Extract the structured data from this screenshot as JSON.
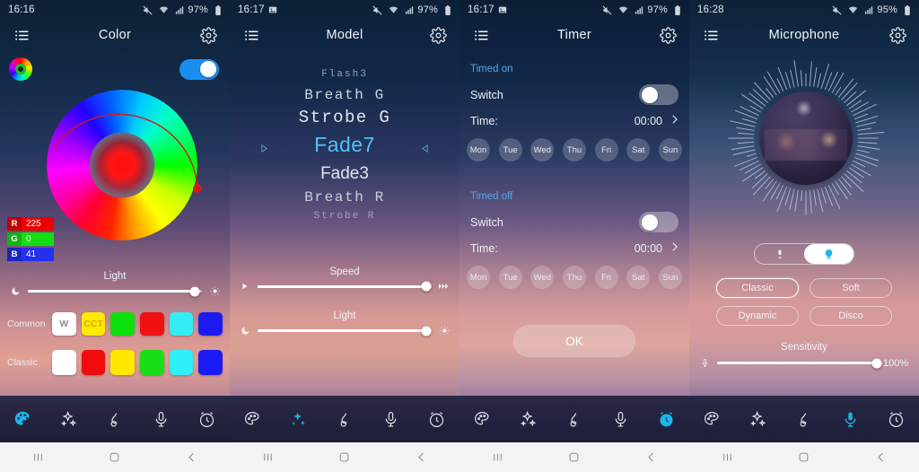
{
  "panels": [
    {
      "status": {
        "clock": "16:16",
        "battery": "97%",
        "icons": [
          "mute-icon",
          "wifi-icon",
          "signal-icon",
          "battery-icon"
        ]
      },
      "header": {
        "title": "Color",
        "menu_icon": "list-menu-icon",
        "settings_icon": "gear-icon"
      },
      "power": {
        "logo_icon": "color-ring-logo",
        "toggle_on": true
      },
      "rgb": {
        "r_label": "R",
        "r_value": "225",
        "g_label": "G",
        "g_value": "0",
        "b_label": "B",
        "b_value": "41"
      },
      "light_slider": {
        "label": "Light",
        "left_icon": "moon-icon",
        "right_icon": "sun-icon",
        "value": 96
      },
      "common": {
        "label": "Common",
        "swatches": [
          {
            "name": "white",
            "text": "W",
            "color": "#ffffff",
            "text_color": "#8d8d8d"
          },
          {
            "name": "cct",
            "text": "CCT",
            "color": "#ffeb00",
            "text_color": "#e0a500"
          },
          {
            "name": "green",
            "text": "",
            "color": "#0ddf0d",
            "text_color": "#ffffff"
          },
          {
            "name": "red",
            "text": "",
            "color": "#f01111",
            "text_color": "#ffffff"
          },
          {
            "name": "cyan",
            "text": "",
            "color": "#35ecf5",
            "text_color": "#ffffff"
          },
          {
            "name": "blue",
            "text": "",
            "color": "#1b1bf0",
            "text_color": "#ffffff"
          }
        ]
      },
      "classic": {
        "label": "Classic",
        "swatches": [
          {
            "name": "white",
            "text": "",
            "color": "#ffffff",
            "text_color": "#888888"
          },
          {
            "name": "red",
            "text": "",
            "color": "#f00c0c",
            "text_color": "#ffffff"
          },
          {
            "name": "yellow",
            "text": "",
            "color": "#ffe800",
            "text_color": "#ffffff"
          },
          {
            "name": "green",
            "text": "",
            "color": "#18e018",
            "text_color": "#ffffff"
          },
          {
            "name": "cyan",
            "text": "",
            "color": "#2ef0f8",
            "text_color": "#ffffff"
          },
          {
            "name": "blue",
            "text": "",
            "color": "#1a1af2",
            "text_color": "#ffffff"
          }
        ]
      },
      "tabs": [
        {
          "name": "color",
          "icon": "palette-icon",
          "active": true
        },
        {
          "name": "mode",
          "icon": "sparkles-icon",
          "active": false
        },
        {
          "name": "music",
          "icon": "music-note-icon",
          "active": false
        },
        {
          "name": "microphone",
          "icon": "microphone-icon",
          "active": false
        },
        {
          "name": "timer",
          "icon": "alarm-clock-icon",
          "active": false
        }
      ]
    },
    {
      "status": {
        "clock": "16:17",
        "battery": "97%"
      },
      "header": {
        "title": "Model",
        "menu_icon": "list-menu-icon",
        "settings_icon": "gear-icon"
      },
      "models": [
        {
          "label": "Flash3",
          "state": "far-top"
        },
        {
          "label": "Breath G",
          "state": "mid-top"
        },
        {
          "label": "Strobe G",
          "state": "near-top"
        },
        {
          "label": "Fade7",
          "state": "selected"
        },
        {
          "label": "Fade3",
          "state": "near-bottom"
        },
        {
          "label": "Breath R",
          "state": "mid-bottom"
        },
        {
          "label": "Strobe R",
          "state": "far-bottom"
        }
      ],
      "arrows": {
        "left_icon": "triangle-right-icon",
        "right_icon": "triangle-left-icon"
      },
      "speed_slider": {
        "label": "Speed",
        "left_icon": "slow-icon",
        "right_icon": "fast-icon",
        "value": 97
      },
      "light_slider": {
        "label": "Light",
        "left_icon": "moon-icon",
        "right_icon": "sun-icon",
        "value": 97
      },
      "tabs": [
        {
          "name": "color",
          "icon": "palette-icon",
          "active": false
        },
        {
          "name": "mode",
          "icon": "sparkles-icon",
          "active": true
        },
        {
          "name": "music",
          "icon": "music-note-icon",
          "active": false
        },
        {
          "name": "microphone",
          "icon": "microphone-icon",
          "active": false
        },
        {
          "name": "timer",
          "icon": "alarm-clock-icon",
          "active": false
        }
      ]
    },
    {
      "status": {
        "clock": "16:17",
        "battery": "97%"
      },
      "header": {
        "title": "Timer",
        "menu_icon": "list-menu-icon",
        "settings_icon": "gear-icon"
      },
      "timed_on": {
        "section_label": "Timed on",
        "switch_label": "Switch",
        "switch_on": false,
        "time_label": "Time:",
        "time_value": "00:00",
        "chevron_icon": "chevron-right-icon",
        "days": [
          "Mon",
          "Tue",
          "Wed",
          "Thu",
          "Fri",
          "Sat",
          "Sun"
        ]
      },
      "timed_off": {
        "section_label": "Timed off",
        "switch_label": "Switch",
        "switch_on": false,
        "time_label": "Time:",
        "time_value": "00:00",
        "chevron_icon": "chevron-right-icon",
        "days": [
          "Mon",
          "Tue",
          "Wed",
          "Thu",
          "Fri",
          "Sat",
          "Sun"
        ]
      },
      "ok_button": "OK",
      "tabs": [
        {
          "name": "color",
          "icon": "palette-icon",
          "active": false
        },
        {
          "name": "mode",
          "icon": "sparkles-icon",
          "active": false
        },
        {
          "name": "music",
          "icon": "music-note-icon",
          "active": false
        },
        {
          "name": "microphone",
          "icon": "microphone-icon",
          "active": false
        },
        {
          "name": "timer",
          "icon": "alarm-clock-icon",
          "active": true
        }
      ]
    },
    {
      "status": {
        "clock": "16:28",
        "battery": "95%"
      },
      "header": {
        "title": "Microphone",
        "menu_icon": "list-menu-icon",
        "settings_icon": "gear-icon"
      },
      "visualizer": {
        "name": "audio-sphere-visualizer"
      },
      "source_toggle": {
        "left_icon": "microphone-icon",
        "right_icon": "lightbulb-icon",
        "selected": "right"
      },
      "modes": [
        {
          "label": "Classic",
          "selected": true
        },
        {
          "label": "Soft",
          "selected": false
        },
        {
          "label": "Dynamic",
          "selected": false
        },
        {
          "label": "Disco",
          "selected": false
        }
      ],
      "sensitivity": {
        "label": "Sensitivity",
        "left_icon": "microphone-icon",
        "value": 100,
        "value_text": "100%"
      },
      "tabs": [
        {
          "name": "color",
          "icon": "palette-icon",
          "active": false
        },
        {
          "name": "mode",
          "icon": "sparkles-icon",
          "active": false
        },
        {
          "name": "music",
          "icon": "music-note-icon",
          "active": false
        },
        {
          "name": "microphone",
          "icon": "microphone-icon",
          "active": true
        },
        {
          "name": "timer",
          "icon": "alarm-clock-icon",
          "active": false
        }
      ]
    }
  ],
  "navbar": {
    "recents_icon": "recents-icon",
    "home_icon": "home-icon",
    "back_icon": "back-icon"
  },
  "colors": {
    "accent": "#4fc3f7",
    "toggle_on": "#1b8ef2",
    "section_title": "#4fa9e8"
  }
}
